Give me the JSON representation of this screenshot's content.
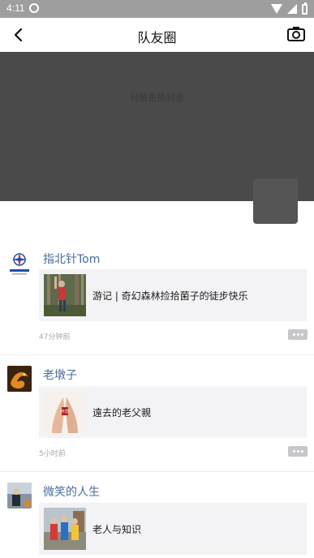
{
  "status_bar": {
    "time": "4:11"
  },
  "header": {
    "title": "队友圈"
  },
  "cover": {
    "hint": "轻触更换封面"
  },
  "posts": [
    {
      "author": "指北针Tom",
      "share_title": "游记 | 奇幻森林捡拾菌子的徒步快乐",
      "time": "47分钟前"
    },
    {
      "author": "老墩子",
      "share_title": "遠去的老父親",
      "time": "5小时前"
    },
    {
      "author": "微笑的人生",
      "share_title": "老人与知识",
      "time": ""
    }
  ],
  "colors": {
    "author": "#4a6b9b",
    "cover_bg": "#4a4a4a",
    "status_bar": "#9e9e9e",
    "card_bg": "#f3f3f5"
  }
}
